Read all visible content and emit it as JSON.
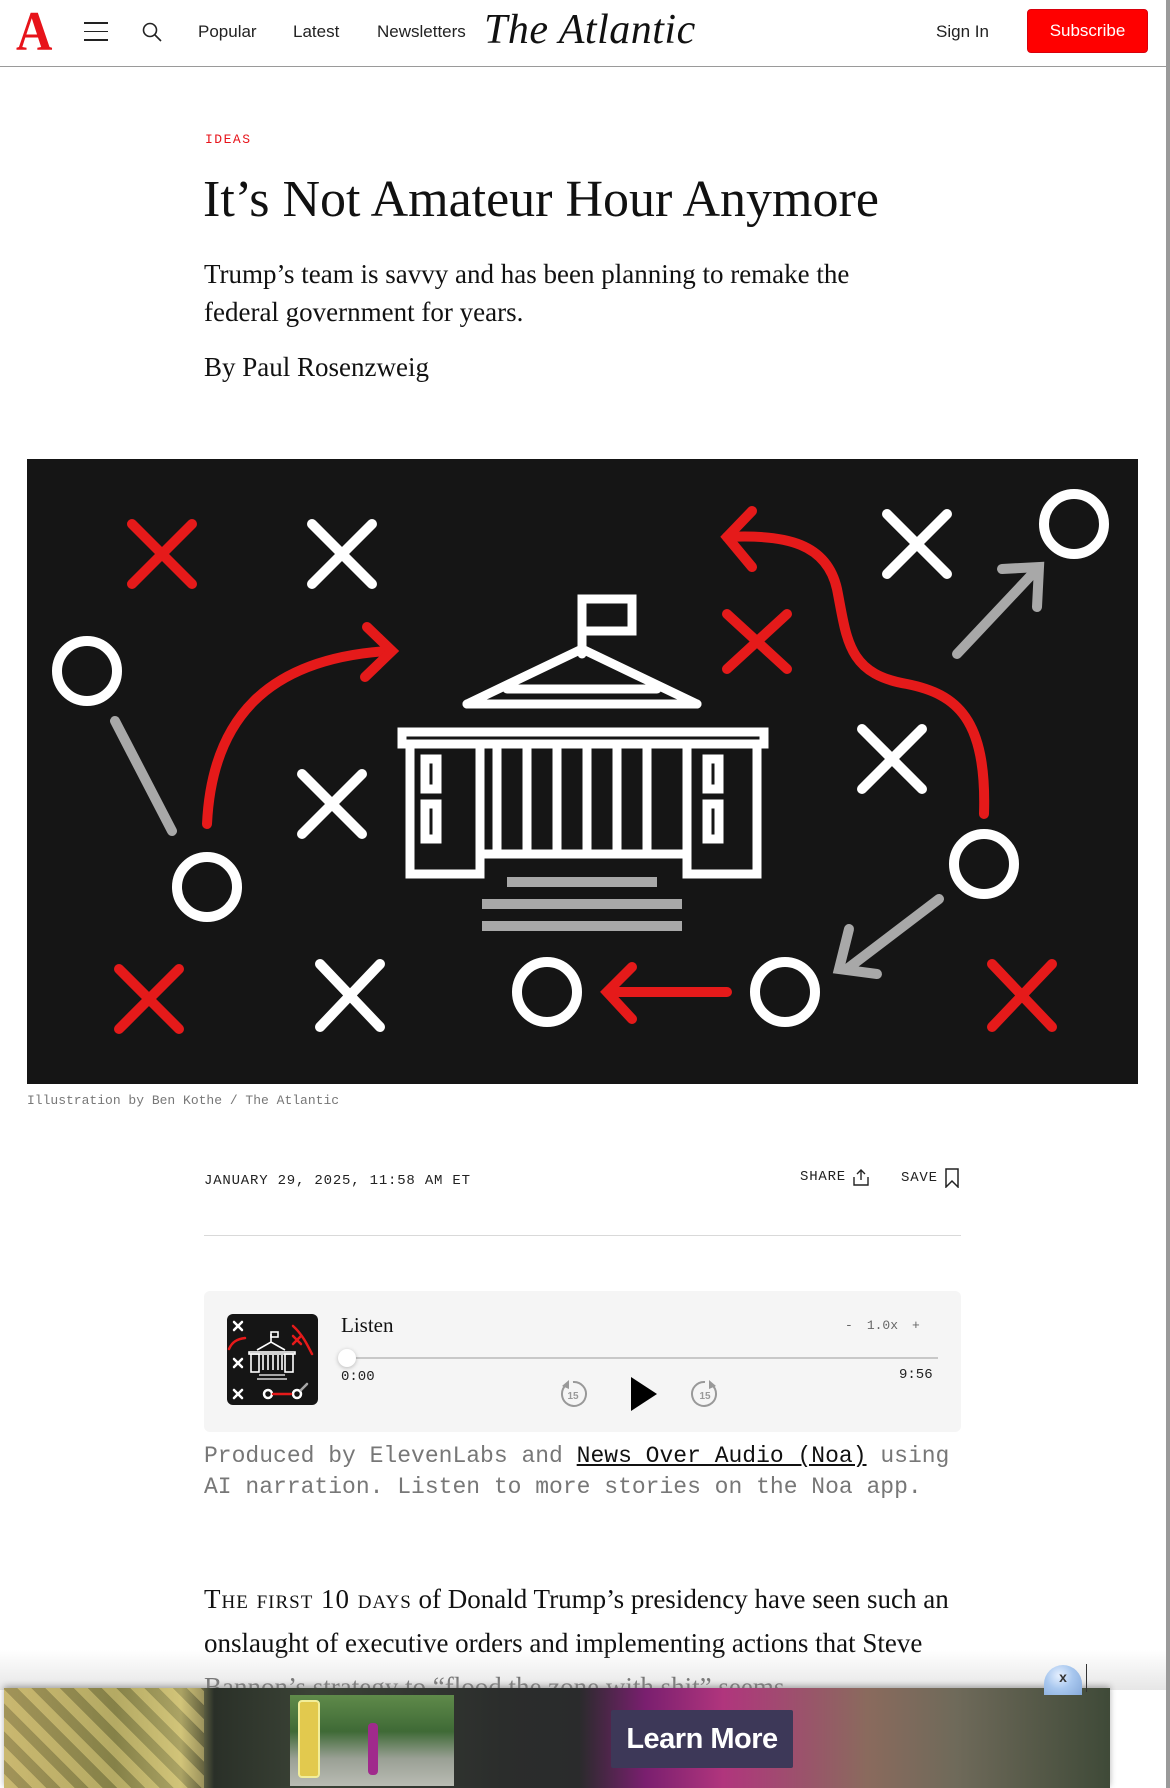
{
  "header": {
    "logo_letter": "A",
    "nav": [
      "Popular",
      "Latest",
      "Newsletters"
    ],
    "wordmark": "The Atlantic",
    "sign_in": "Sign In",
    "subscribe": "Subscribe",
    "icons": {
      "menu": "hamburger-icon",
      "search": "search-icon"
    }
  },
  "article": {
    "section": "IDEAS",
    "title": "It’s Not Amateur Hour Anymore",
    "dek": "Trump’s team is savvy and has been planning to remake the federal government for years.",
    "byline_prefix": "By ",
    "author": "Paul Rosenzweig",
    "image_caption": "Illustration by Ben Kothe / The Atlantic",
    "dateline": "JANUARY 29, 2025, 11:58 AM ET",
    "share_label": "SHARE",
    "save_label": "SAVE",
    "body_smallcaps": "The first 10 days",
    "body_text": " of Donald Trump’s presidency have seen such an onslaught of executive orders and implementing actions that Steve Bannon’s strategy to “flood the zone with shit” seems"
  },
  "player": {
    "title": "Listen",
    "speed_minus": "-",
    "speed": "1.0x",
    "speed_plus": "+",
    "current_time": "0:00",
    "total_time": "9:56",
    "progress": 0,
    "skip_back": "15",
    "skip_forward": "15"
  },
  "credits": {
    "prefix": "Produced by ElevenLabs and ",
    "link": "News Over Audio (Noa)",
    "suffix": " using AI narration. Listen to more stories on the Noa app."
  },
  "ad": {
    "cta": "Learn More",
    "close": "x"
  },
  "colors": {
    "brand_red": "#e7131a",
    "subscribe_bg": "#ff0000",
    "illustration_bg": "#151515",
    "player_bg": "#f5f5f5",
    "ad_button": "#3d3858"
  }
}
